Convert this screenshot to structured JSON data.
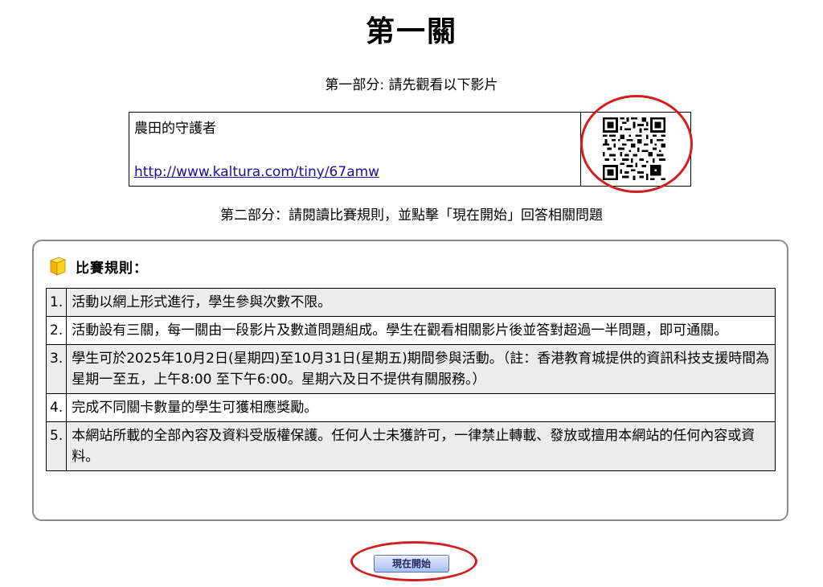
{
  "page": {
    "title": "第一關",
    "part1_caption": "第一部分: 請先觀看以下影片",
    "part2_caption": "第二部分：請閱讀比賽規則，並點擊「現在開始」回答相關問題"
  },
  "video": {
    "title": "農田的守護者",
    "link": "http://www.kaltura.com/tiny/67amw",
    "qr_icon": "qr-code-icon"
  },
  "rules": {
    "icon": "cube-icon",
    "heading": "比賽規則：",
    "items": [
      {
        "num": "1.",
        "text": "活動以網上形式進行，學生參與次數不限。"
      },
      {
        "num": "2.",
        "text": "活動設有三關，每一關由一段影片及數道問題組成。學生在觀看相關影片後並答對超過一半問題，即可通關。"
      },
      {
        "num": "3.",
        "text": "學生可於2025年10月2日(星期四)至10月31日(星期五)期間參與活動。（註：香港教育城提供的資訊科技支援時間為星期一至五，上午8:00 至下午6:00。星期六及日不提供有關服務。）"
      },
      {
        "num": "4.",
        "text": "完成不同關卡數量的學生可獲相應獎勵。"
      },
      {
        "num": "5.",
        "text": "本網站所載的全部內容及資料受版權保護。任何人士未獲許可，一律禁止轉載、發放或擅用本網站的任何內容或資料。"
      }
    ]
  },
  "actions": {
    "start_label": "現在開始"
  },
  "colors": {
    "annotation_red": "#d21e1e",
    "link_blue": "#1a0dab",
    "odd_row_bg": "#ececec",
    "panel_border": "#8a8a8a"
  }
}
